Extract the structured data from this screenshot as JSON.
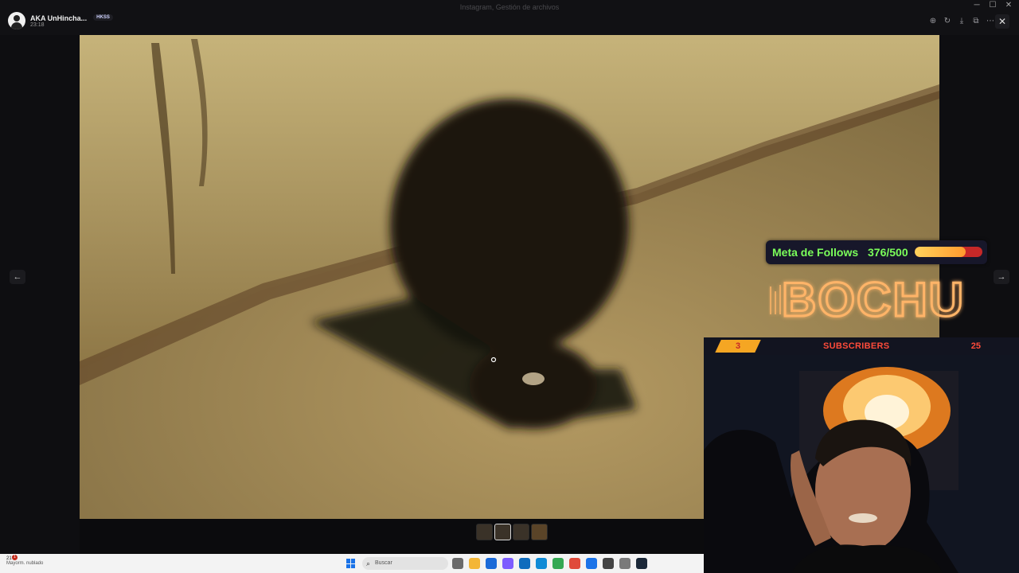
{
  "window": {
    "title": "Instagram, Gestión de archivos",
    "controls": [
      "─",
      "☐",
      "✕"
    ]
  },
  "viewer": {
    "author_name": "AKA UnHincha...",
    "timestamp": "23:18",
    "badge": "HKSS",
    "tools": [
      "zoom-in-icon",
      "rotate-icon",
      "download-icon",
      "open-external-icon",
      "more-icon"
    ],
    "close_label": "✕",
    "prev_label": "←",
    "next_label": "→"
  },
  "thumbnails": {
    "count": 4,
    "active_index": 1
  },
  "taskbar": {
    "weather_temp": "21°C",
    "weather_desc": "Mayorm. nublado",
    "notification_count": "1",
    "search_placeholder": "Buscar",
    "apps": [
      "#6b6b6b",
      "#f3b636",
      "#1a6ad8",
      "#7d5cff",
      "#0f6cbd",
      "#0f8bd6",
      "#34a853",
      "#e04a3a",
      "#1a73e8",
      "#444",
      "#7a7a7a",
      "#1b2838"
    ]
  },
  "overlay": {
    "follows_label": "Meta de Follows",
    "follows_value": "376/500",
    "follows_progress": 0.75,
    "brand": "BOCHU",
    "subscribers_count": "3",
    "subscribers_label": "SUBSCRIBERS",
    "subscribers_goal": "25",
    "colors": {
      "follows_text": "#7bff5a",
      "brand_glow": "#ff9b3d",
      "sub_label": "#ff4b3a"
    }
  }
}
